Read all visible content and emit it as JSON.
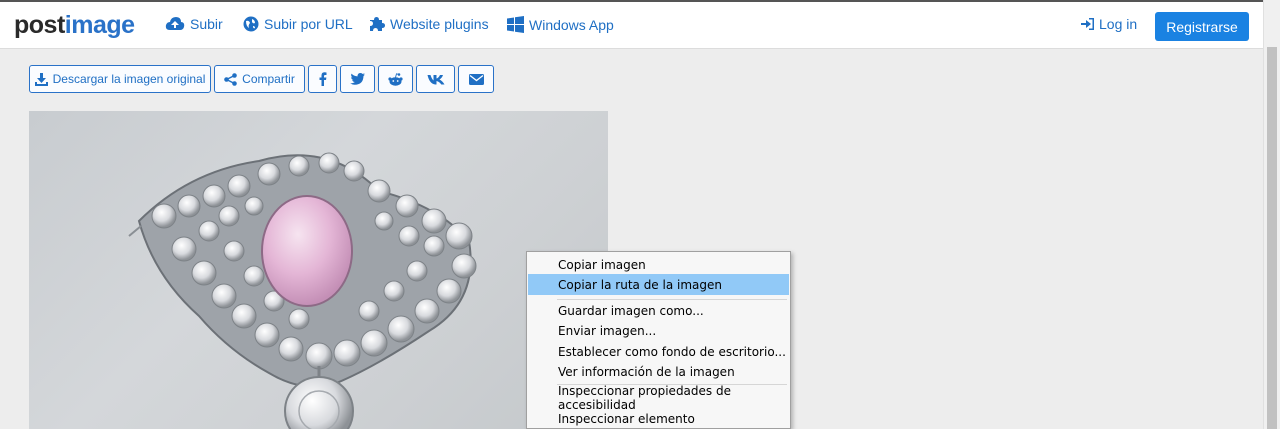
{
  "navbar": {
    "logo_part1": "post",
    "logo_part2": "image",
    "links": [
      {
        "label": "Subir",
        "icon": "cloud-upload-icon"
      },
      {
        "label": "Subir por URL",
        "icon": "globe-icon"
      },
      {
        "label": "Website plugins",
        "icon": "puzzle-icon"
      },
      {
        "label": "Windows App",
        "icon": "windows-icon"
      }
    ],
    "login_label": "Log in",
    "register_label": "Registrarse"
  },
  "toolbar": {
    "download_label": "Descargar la imagen original",
    "share_label": "Compartir",
    "social_icons": [
      "facebook-icon",
      "twitter-icon",
      "reddit-icon",
      "vk-icon",
      "envelope-icon"
    ]
  },
  "context_menu": {
    "items": [
      "Copiar imagen",
      "Copiar la ruta de la imagen",
      "Guardar imagen como...",
      "Enviar imagen...",
      "Establecer como fondo de escritorio...",
      "Ver información de la imagen",
      "Inspeccionar propiedades de accesibilidad",
      "Inspeccionar elemento"
    ],
    "highlighted_index": 1
  },
  "colors": {
    "accent": "#1f6fc4",
    "register_bg": "#1a82e2",
    "menu_highlight": "#91c9f7"
  }
}
